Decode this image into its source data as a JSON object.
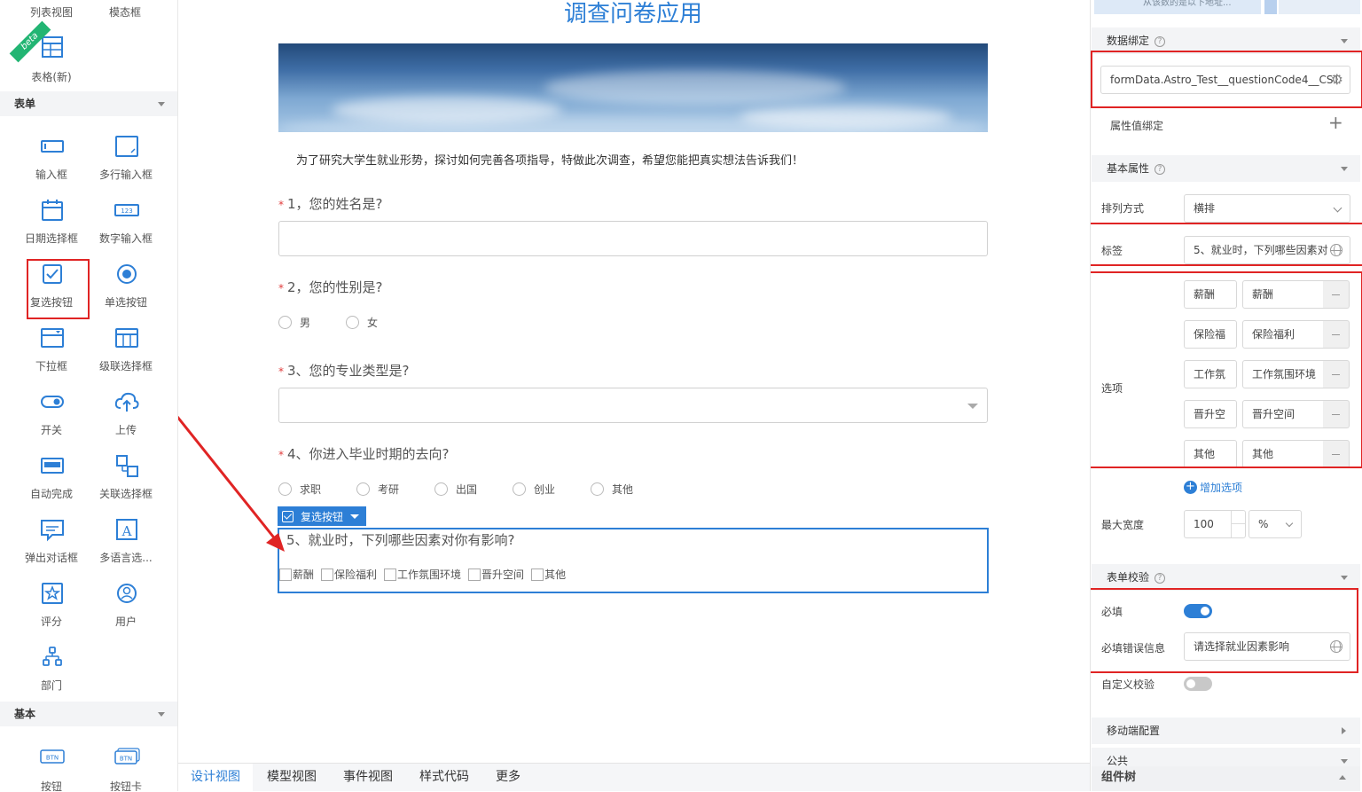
{
  "palette": {
    "top_items": [
      {
        "label": "列表视图"
      },
      {
        "label": "模态框"
      }
    ],
    "table_new": {
      "label": "表格(新)",
      "badge": "beta"
    },
    "sections": [
      {
        "title": "表单"
      },
      {
        "title": "基本"
      }
    ],
    "form_items": [
      {
        "label": "输入框",
        "icon": "input-icon"
      },
      {
        "label": "多行输入框",
        "icon": "textarea-icon"
      },
      {
        "label": "日期选择框",
        "icon": "calendar-icon"
      },
      {
        "label": "数字输入框",
        "icon": "number-input-icon"
      },
      {
        "label": "复选按钮",
        "icon": "checkbox-icon"
      },
      {
        "label": "单选按钮",
        "icon": "radio-icon"
      },
      {
        "label": "下拉框",
        "icon": "dropdown-icon"
      },
      {
        "label": "级联选择框",
        "icon": "cascader-icon"
      },
      {
        "label": "开关",
        "icon": "switch-icon"
      },
      {
        "label": "上传",
        "icon": "upload-cloud-icon"
      },
      {
        "label": "自动完成",
        "icon": "autocomplete-icon"
      },
      {
        "label": "关联选择框",
        "icon": "relation-select-icon"
      },
      {
        "label": "弹出对话框",
        "icon": "popup-dialog-icon"
      },
      {
        "label": "多语言选...",
        "icon": "multilang-icon"
      },
      {
        "label": "评分",
        "icon": "star-rating-icon"
      },
      {
        "label": "用户",
        "icon": "user-icon"
      },
      {
        "label": "部门",
        "icon": "department-icon"
      }
    ],
    "basic_items": [
      {
        "label": "按钮",
        "icon": "button-icon",
        "icon_text": "BTN"
      },
      {
        "label": "按钮卡",
        "icon": "button-card-icon",
        "icon_text": "BTN"
      }
    ]
  },
  "form": {
    "title": "调查问卷应用",
    "intro": "为了研究大学生就业形势，探讨如何完善各项指导，特做此次调查，希望您能把真实想法告诉我们！",
    "required_mark": "*",
    "q1": "1，您的姓名是?",
    "q2": "2，您的性别是?",
    "q2_options": [
      "男",
      "女"
    ],
    "q3": "3、您的专业类型是?",
    "q4": "4、你进入毕业时期的去向?",
    "q4_options": [
      "求职",
      "考研",
      "出国",
      "创业",
      "其他"
    ],
    "selected_tag": "复选按钮",
    "q5": "5、就业时，下列哪些因素对你有影响?",
    "q5_options": [
      "薪酬",
      "保险福利",
      "工作氛围环境",
      "晋升空间",
      "其他"
    ]
  },
  "bottom_tabs": [
    "设计视图",
    "模型视图",
    "事件视图",
    "样式代码",
    "更多"
  ],
  "active_tab": "设计视图",
  "props": {
    "top_partial_text": "从该数的是以下地址...",
    "data_binding": {
      "title": "数据绑定",
      "value": "formData.Astro_Test__questionCode4__CST"
    },
    "attr_binding": {
      "label": "属性值绑定"
    },
    "basic": {
      "title": "基本属性"
    },
    "layout": {
      "label": "排列方式",
      "value": "横排"
    },
    "tag": {
      "label": "标签",
      "value": "5、就业时，下列哪些因素对"
    },
    "options": {
      "label": "选项",
      "items": [
        {
          "key": "薪酬",
          "value": "薪酬"
        },
        {
          "key": "保险福",
          "value": "保险福利"
        },
        {
          "key": "工作氛",
          "value": "工作氛围环境"
        },
        {
          "key": "晋升空",
          "value": "晋升空间"
        },
        {
          "key": "其他",
          "value": "其他"
        }
      ],
      "add": "增加选项"
    },
    "max_width": {
      "label": "最大宽度",
      "value": "100",
      "unit": "%"
    },
    "validation": {
      "title": "表单校验"
    },
    "required": {
      "label": "必填",
      "on": true
    },
    "required_msg": {
      "label": "必填错误信息",
      "value": "请选择就业因素影响"
    },
    "custom_validation": {
      "label": "自定义校验",
      "on": false
    },
    "mobile": {
      "title": "移动端配置"
    },
    "public": {
      "title": "公共"
    },
    "tree": {
      "title": "组件树"
    }
  },
  "colors": {
    "accent": "#2d7fd6",
    "annotation_red": "#e02424",
    "required_star": "#e03b3b"
  }
}
